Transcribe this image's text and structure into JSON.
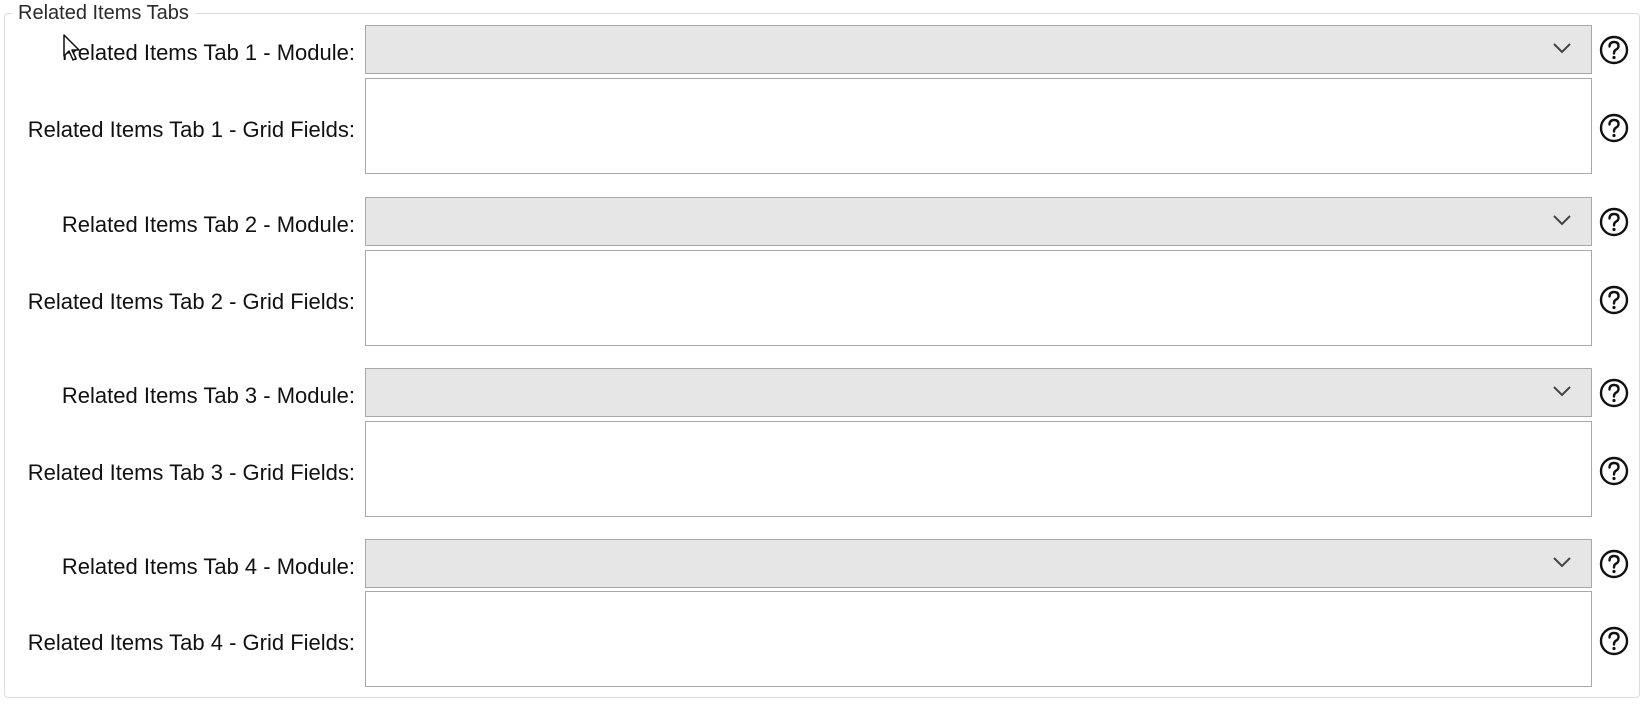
{
  "group": {
    "title": "Related Items Tabs"
  },
  "fields": [
    {
      "module_label": "Related Items Tab 1 - Module:",
      "module_value": "",
      "grid_label": "Related Items Tab 1 - Grid Fields:",
      "grid_value": ""
    },
    {
      "module_label": "Related Items Tab 2 - Module:",
      "module_value": "",
      "grid_label": "Related Items Tab 2 - Grid Fields:",
      "grid_value": ""
    },
    {
      "module_label": "Related Items Tab 3 - Module:",
      "module_value": "",
      "grid_label": "Related Items Tab 3 - Grid Fields:",
      "grid_value": ""
    },
    {
      "module_label": "Related Items Tab 4 - Module:",
      "module_value": "",
      "grid_label": "Related Items Tab 4 - Grid Fields:",
      "grid_value": ""
    }
  ],
  "icons": {
    "dropdown": "chevron-down-icon",
    "help": "help-circle-icon",
    "cursor": "mouse-pointer-icon"
  },
  "colors": {
    "select_background": "#e6e6e6",
    "border": "#a8a8a8",
    "group_border": "#d6dde3"
  }
}
